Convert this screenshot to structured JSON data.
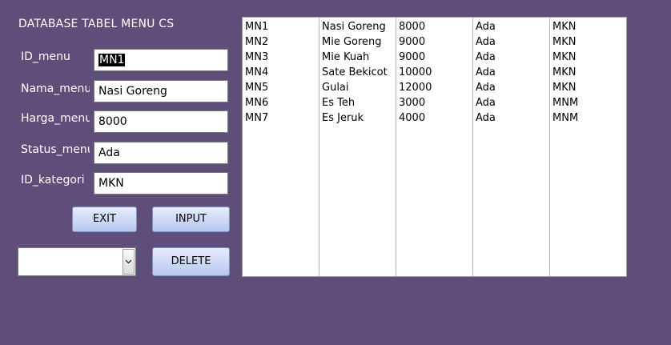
{
  "app": {
    "title": "DATABASE TABEL MENU CS"
  },
  "form": {
    "id_menu": {
      "label": "ID_menu",
      "value": "MN1"
    },
    "nama_menu": {
      "label": "Nama_menu",
      "value": "Nasi Goreng"
    },
    "harga_menu": {
      "label": "Harga_menu",
      "value": "8000"
    },
    "status_menu": {
      "label": "Status_menu",
      "value": "Ada"
    },
    "id_kategori": {
      "label": "ID_kategori",
      "value": "MKN"
    }
  },
  "buttons": {
    "exit": "EXIT",
    "input": "INPUT",
    "delete": "DELETE"
  },
  "combo": {
    "selected": ""
  },
  "table": {
    "rows": [
      [
        "MN1",
        "Nasi Goreng",
        "8000",
        "Ada",
        "MKN"
      ],
      [
        "MN2",
        "Mie Goreng",
        "9000",
        "Ada",
        "MKN"
      ],
      [
        "MN3",
        "Mie Kuah",
        "9000",
        "Ada",
        "MKN"
      ],
      [
        "MN4",
        "Sate Bekicot",
        "10000",
        "Ada",
        "MKN"
      ],
      [
        "MN5",
        "Gulai",
        "12000",
        "Ada",
        "MKN"
      ],
      [
        "MN6",
        "Es Teh",
        "3000",
        "Ada",
        "MNM"
      ],
      [
        "MN7",
        "Es Jeruk",
        "4000",
        "Ada",
        "MNM"
      ]
    ]
  },
  "colors": {
    "background": "#604e7a",
    "button_top": "#e6ecfb",
    "button_bottom": "#b7c7f0"
  },
  "icons": {
    "combo_arrow": "chevron-down-icon"
  }
}
